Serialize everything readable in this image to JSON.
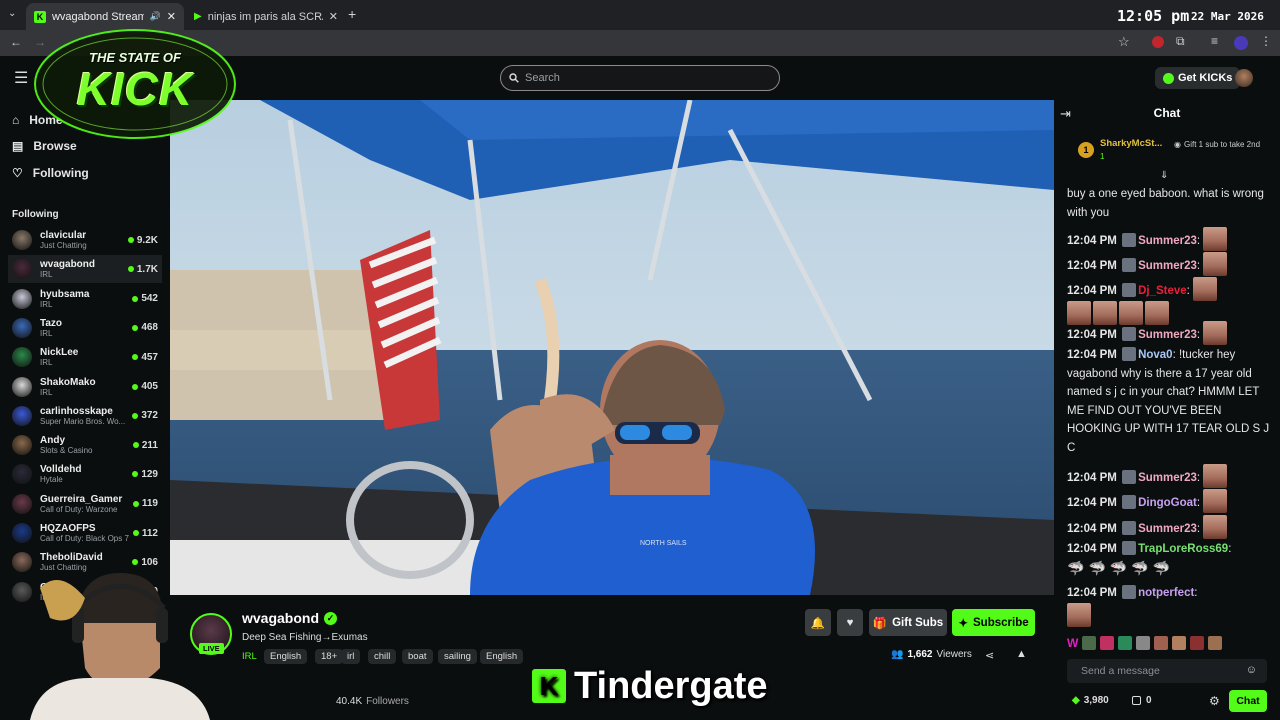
{
  "browser": {
    "tabs": [
      {
        "title": "wvagabond Stream - Watch",
        "favicon": "kick-icon"
      },
      {
        "title": "ninjas im paris ala SCRABSNYC",
        "favicon": "play-icon"
      }
    ],
    "clock_time": "12:05 pm",
    "clock_date": "22 Mar 2026"
  },
  "overlay": {
    "logo_top": "THE STATE OF",
    "logo_main": "KICK"
  },
  "header": {
    "search_placeholder": "Search",
    "get_kicks_label": "Get KICKs"
  },
  "sidebar": {
    "nav": [
      {
        "label": "Home",
        "icon": "home-icon"
      },
      {
        "label": "Browse",
        "icon": "browse-icon"
      },
      {
        "label": "Following",
        "icon": "heart-icon"
      }
    ],
    "following_heading": "Following",
    "following": [
      {
        "name": "clavicular",
        "category": "Just Chatting",
        "viewers": "9.2K",
        "color": "#8a7a6a"
      },
      {
        "name": "wvagabond",
        "category": "IRL",
        "viewers": "1.7K",
        "color": "#4a2a3a"
      },
      {
        "name": "hyubsama",
        "category": "IRL",
        "viewers": "542",
        "color": "#c8c8d8"
      },
      {
        "name": "Tazo",
        "category": "IRL",
        "viewers": "468",
        "color": "#3a6ab8"
      },
      {
        "name": "NickLee",
        "category": "IRL",
        "viewers": "457",
        "color": "#2a8a4a"
      },
      {
        "name": "ShakoMako",
        "category": "IRL",
        "viewers": "405",
        "color": "#d8d8d8"
      },
      {
        "name": "carlinhosskape",
        "category": "Super Mario Bros. Wo...",
        "viewers": "372",
        "color": "#3a5ad8"
      },
      {
        "name": "Andy",
        "category": "Slots & Casino",
        "viewers": "211",
        "color": "#8a6a4a"
      },
      {
        "name": "Volldehd",
        "category": "Hytale",
        "viewers": "129",
        "color": "#2a2a3a"
      },
      {
        "name": "Guerreira_Gamer",
        "category": "Call of Duty: Warzone",
        "viewers": "119",
        "color": "#6a3a4a"
      },
      {
        "name": "HQZAOFPS",
        "category": "Call of Duty: Black Ops 7",
        "viewers": "112",
        "color": "#1a3a8a"
      },
      {
        "name": "TheboliDavid",
        "category": "Just Chatting",
        "viewers": "106",
        "color": "#8a6a5a"
      },
      {
        "name": "Cell",
        "category": "IRL",
        "viewers": "90",
        "color": "#5a5a5a"
      }
    ]
  },
  "stream": {
    "channel": "wvagabond",
    "live_label": "LIVE",
    "title": "Deep Sea Fishing→Exumas",
    "tags": [
      "IRL",
      "English",
      "18+",
      "irl",
      "chill",
      "boat",
      "sailing",
      "English"
    ],
    "viewers": "1,662",
    "viewers_label": "Viewers",
    "followers": "40.4K",
    "followers_label": "Followers",
    "gift_subs_label": "Gift Subs",
    "subscribe_label": "Subscribe",
    "shirt_text": "NORTH SAILS",
    "subtitle_text": "Tindergate"
  },
  "chat": {
    "heading": "Chat",
    "pinned_gifter": {
      "name": "SharkyMcSt...",
      "rank": "1",
      "count": "1",
      "gift_text": "Gift 1 sub to take 2nd"
    },
    "first_message": "buy a one eyed baboon. what is wrong with you",
    "messages": [
      {
        "time": "12:04 PM",
        "user": "Summer23",
        "color": "#f0a8c0",
        "text": ""
      },
      {
        "time": "12:04 PM",
        "user": "Summer23",
        "color": "#f0a8c0",
        "text": ""
      },
      {
        "time": "12:04 PM",
        "user": "Dj_Steve",
        "color": "#e8203c",
        "text": ""
      },
      {
        "time": "12:04 PM",
        "user": "Summer23",
        "color": "#f0a8c0",
        "text": ""
      },
      {
        "time": "12:04 PM",
        "user": "Nova0",
        "color": "#a8c8f8",
        "text": "!tucker hey vagabond why is there a 17 year old named s j c in your chat? HMMM LET ME FIND OUT YOU'VE BEEN HOOKING UP WITH 17 TEAR OLD S J C"
      },
      {
        "time": "12:04 PM",
        "user": "Summer23",
        "color": "#f0a8c0",
        "text": ""
      },
      {
        "time": "12:04 PM",
        "user": "DingoGoat",
        "color": "#c8a0f0",
        "text": ""
      },
      {
        "time": "12:04 PM",
        "user": "Summer23",
        "color": "#f0a8c0",
        "text": ""
      },
      {
        "time": "12:04 PM",
        "user": "TrapLoreRoss69",
        "color": "#78e070",
        "text": ""
      },
      {
        "time": "12:04 PM",
        "user": "notperfect",
        "color": "#c8a0f0",
        "text": ""
      }
    ],
    "input_placeholder": "Send a message",
    "kicks_balance": "3,980",
    "points": "0",
    "chat_button": "Chat"
  }
}
